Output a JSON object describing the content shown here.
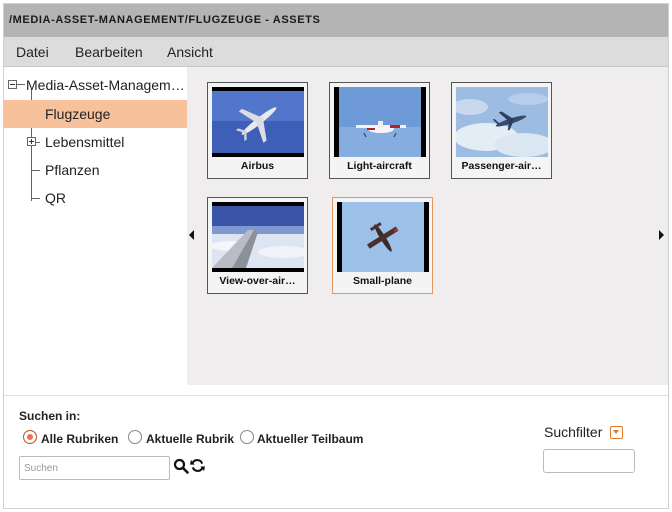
{
  "window": {
    "title": "/MEDIA-ASSET-MANAGEMENT/FLUGZEUGE - ASSETS"
  },
  "menu": {
    "items": [
      "Datei",
      "Bearbeiten",
      "Ansicht"
    ]
  },
  "tree": {
    "root": "Media-Asset-Managem…",
    "items": [
      {
        "label": "Flugzeuge",
        "selected": true,
        "expandable": false
      },
      {
        "label": "Lebensmittel",
        "selected": false,
        "expandable": true
      },
      {
        "label": "Pflanzen",
        "selected": false,
        "expandable": false
      },
      {
        "label": "QR",
        "selected": false,
        "expandable": false
      }
    ]
  },
  "assets": [
    {
      "caption": "Airbus",
      "thumb_icon": "airplane-icon",
      "selected": false
    },
    {
      "caption": "Light-aircraft",
      "thumb_icon": "light-aircraft-icon",
      "selected": false
    },
    {
      "caption": "Passenger-air…",
      "thumb_icon": "passenger-airplane-icon",
      "selected": false
    },
    {
      "caption": "View-over-air…",
      "thumb_icon": "airplane-wing-icon",
      "selected": false
    },
    {
      "caption": "Small-plane",
      "thumb_icon": "small-plane-icon",
      "selected": true
    }
  ],
  "search": {
    "heading": "Suchen in:",
    "options": [
      {
        "label": "Alle Rubriken",
        "checked": true
      },
      {
        "label": "Aktuelle Rubrik",
        "checked": false
      },
      {
        "label": "Aktueller Teilbaum",
        "checked": false
      }
    ],
    "placeholder": "Suchen",
    "icons": [
      "search-icon",
      "refresh-icon"
    ]
  },
  "filter": {
    "label": "Suchfilter",
    "value": ""
  },
  "colors": {
    "selection": "#f7c19b",
    "accent": "#e8704a",
    "titlebar": "#b4b4b4",
    "menubar": "#dcdcdc"
  }
}
